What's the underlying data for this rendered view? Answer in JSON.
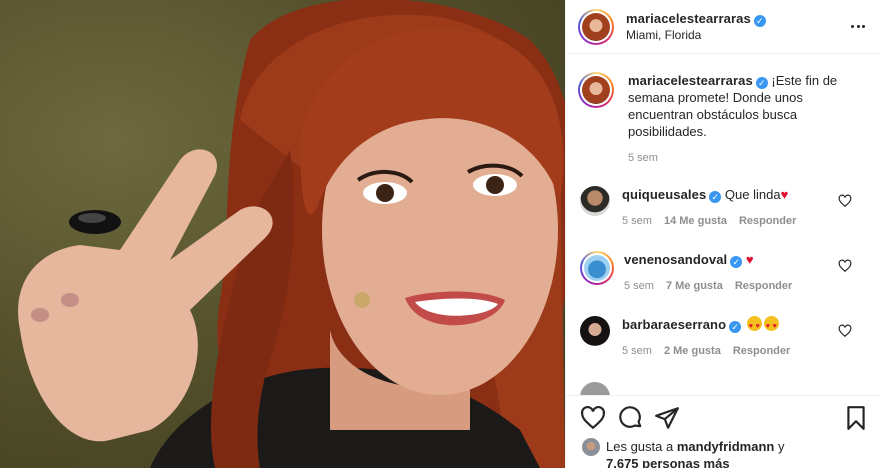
{
  "post": {
    "username": "mariacelestearraras",
    "location": "Miami, Florida",
    "caption": "¡Este fin de semana promete! Donde unos encuentran obstáculos busca posibilidades.",
    "caption_time": "5 sem"
  },
  "comments": [
    {
      "username": "quiqueusales",
      "text": "Que linda",
      "emoji": "heart",
      "time": "5 sem",
      "likes": "14 Me gusta",
      "reply": "Responder"
    },
    {
      "username": "venenosandoval",
      "text": "",
      "emoji": "heart",
      "time": "5 sem",
      "likes": "7 Me gusta",
      "reply": "Responder"
    },
    {
      "username": "barbaraeserrano",
      "text": "",
      "emoji": "heart-eyes-x2",
      "time": "5 sem",
      "likes": "2 Me gusta",
      "reply": "Responder"
    }
  ],
  "likes_summary": {
    "prefix": "Les gusta a",
    "user": "mandyfridmann",
    "suffix": "y",
    "count": "7,675 personas más"
  },
  "icons": {
    "more": "more-options-icon",
    "like": "heart-icon",
    "comment": "comment-icon",
    "share": "paper-plane-icon",
    "save": "bookmark-icon",
    "verified": "verified-badge-icon"
  },
  "colors": {
    "verified": "#3897f0",
    "heart": "#e0102f",
    "muted": "#8e8e8e"
  }
}
